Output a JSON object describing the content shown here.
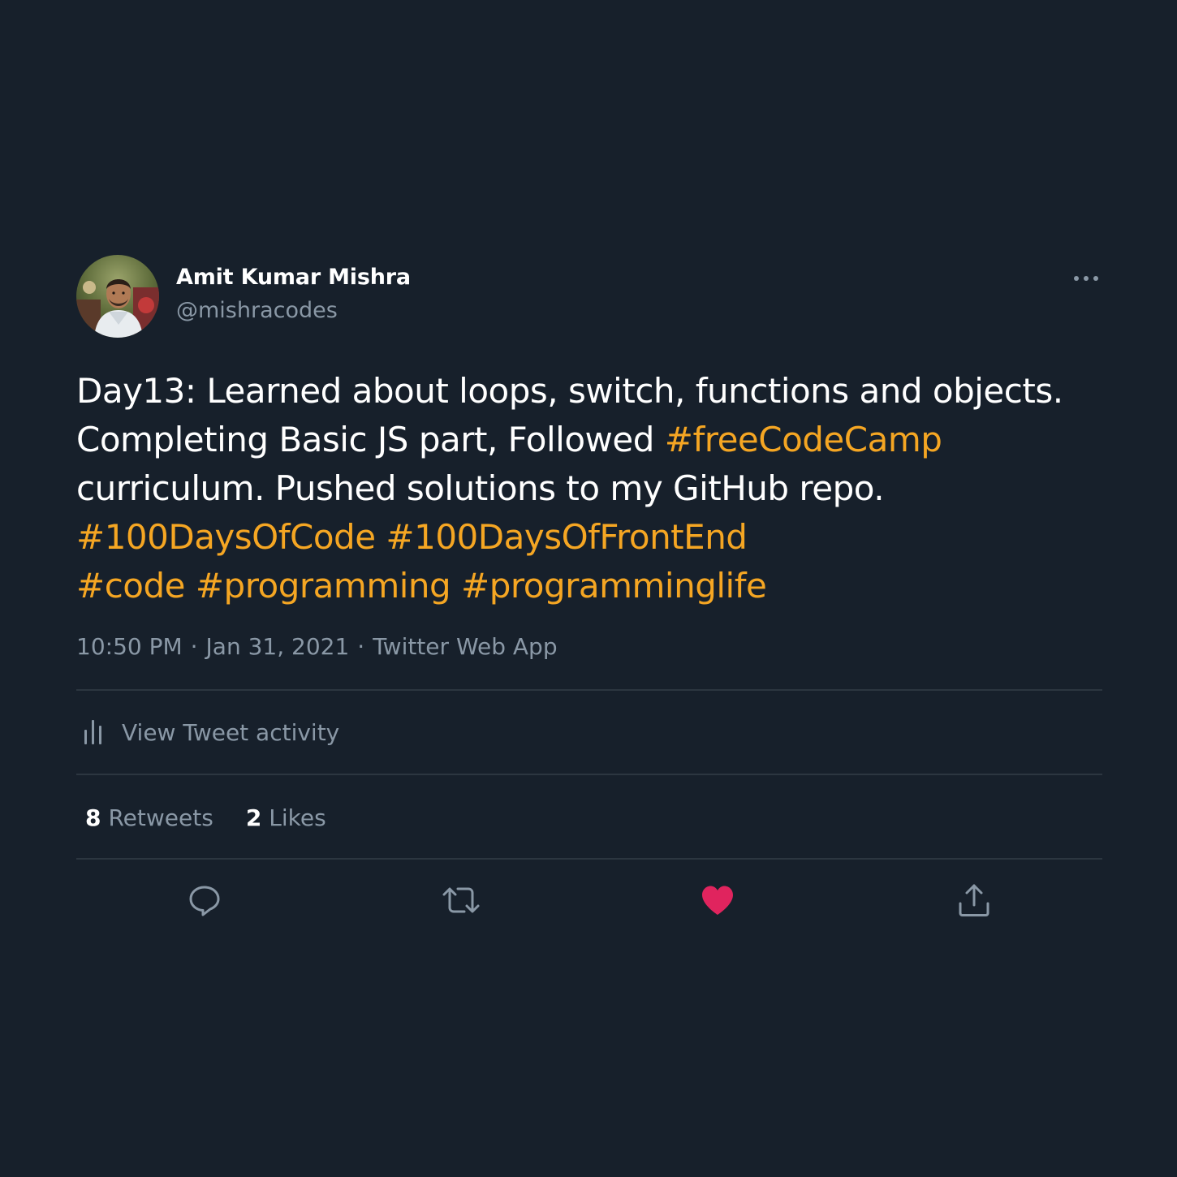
{
  "tweet": {
    "author": {
      "name": "Amit Kumar Mishra",
      "handle": "@mishracodes"
    },
    "body": {
      "line1": "Day13: Learned about loops, switch, functions and objects.",
      "line2_text": "Completing Basic JS part, Followed ",
      "line2_tag": "#freeCodeCamp",
      "line3": "curriculum. Pushed solutions to my GitHub repo.",
      "tags_line4": [
        "#100DaysOfCode",
        "#100DaysOfFrontEnd"
      ],
      "tags_line5": [
        "#code",
        "#programming",
        "#programminglife"
      ]
    },
    "meta": {
      "time": "10:50 PM",
      "date": "Jan 31, 2021",
      "separator": "·",
      "source": "Twitter Web App"
    },
    "activity_label": "View Tweet activity",
    "stats": {
      "retweets_count": "8",
      "retweets_label": "Retweets",
      "likes_count": "2",
      "likes_label": "Likes"
    }
  },
  "icons": {
    "more": "more-options-icon",
    "activity": "bar-chart-icon",
    "reply": "reply-icon",
    "retweet": "retweet-icon",
    "like": "heart-icon",
    "share": "share-icon"
  },
  "colors": {
    "background": "#17202b",
    "hashtag": "#f5a623",
    "secondary_text": "#8a98a6",
    "liked_heart": "#e0245e",
    "divider": "#2c3640"
  }
}
